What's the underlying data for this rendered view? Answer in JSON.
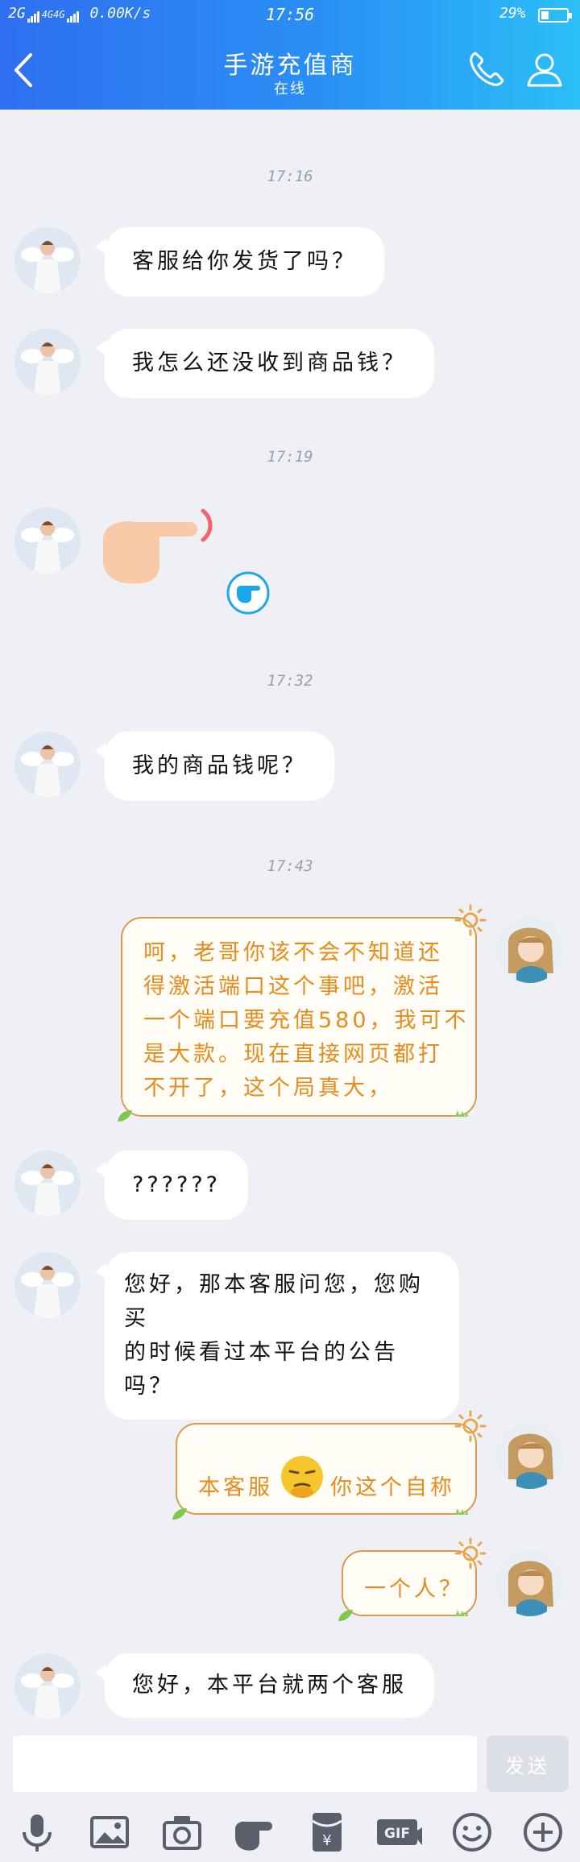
{
  "status_bar": {
    "network_left": "2G",
    "network_mid": "4G4G",
    "speed": "0.00K/s",
    "time": "17:56",
    "battery_pct": "29%",
    "battery_level": 0.29
  },
  "header": {
    "title": "手游充值商",
    "subtitle": "在线"
  },
  "messages": [
    {
      "type": "timestamp",
      "text": "17:16"
    },
    {
      "type": "text",
      "side": "left",
      "text": "客服给你发货了吗？"
    },
    {
      "type": "text",
      "side": "left",
      "text": "我怎么还没收到商品钱？"
    },
    {
      "type": "timestamp",
      "text": "17:19"
    },
    {
      "type": "sticker",
      "side": "left",
      "name": "pointing-hand-sticker"
    },
    {
      "type": "timestamp",
      "text": "17:32"
    },
    {
      "type": "text",
      "side": "left",
      "text": "我的商品钱呢？"
    },
    {
      "type": "timestamp",
      "text": "17:43"
    },
    {
      "type": "text",
      "side": "right",
      "lines": [
        "呵，老哥你该不会不知道还",
        "得激活端口这个事吧，激活",
        "一个端口要充值580，我可不",
        "是大款。现在直接网页都打",
        "不开了，这个局真大，"
      ]
    },
    {
      "type": "text",
      "side": "left",
      "text": "??????"
    },
    {
      "type": "text",
      "side": "left",
      "lines": [
        "您好，那本客服问您，您购买",
        "的时候看过本平台的公告",
        "吗？"
      ]
    },
    {
      "type": "text",
      "side": "right",
      "before": "本客服",
      "emoji": "smug-face-emoji",
      "after": "你这个自称"
    },
    {
      "type": "text",
      "side": "right",
      "text": "一个人？"
    },
    {
      "type": "text",
      "side": "left",
      "text": "您好，本平台就两个客服"
    }
  ],
  "input": {
    "value": "",
    "placeholder": ""
  },
  "send_label": "发送",
  "toolbar": [
    "microphone-icon",
    "image-icon",
    "camera-icon",
    "poke-hand-icon",
    "red-packet-icon",
    "gif-icon",
    "emoji-icon",
    "plus-icon"
  ],
  "colors": {
    "header_start": "#2f6ff0",
    "header_end": "#2bbff7",
    "bubble_right_text": "#e78b1c",
    "bubble_right_border": "#d89b48",
    "background": "#eef0f6"
  }
}
